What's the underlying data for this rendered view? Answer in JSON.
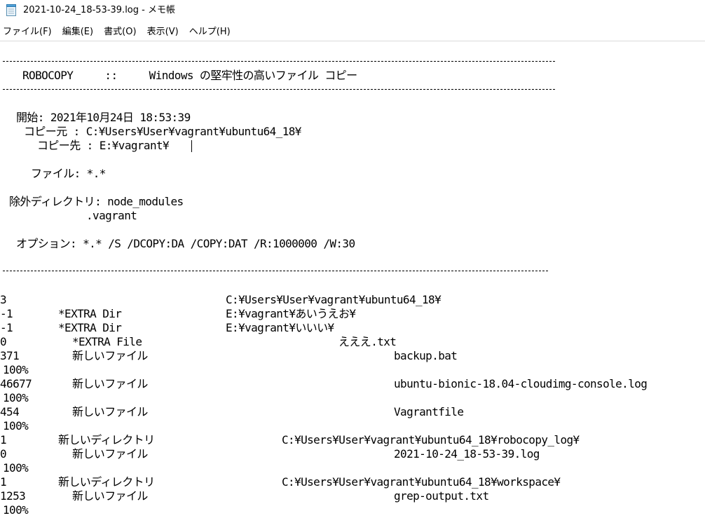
{
  "window": {
    "title": "2021-10-24_18-53-39.log - メモ帳",
    "icon": "notepad-icon"
  },
  "menu": [
    {
      "label": "ファイル(F)"
    },
    {
      "label": "編集(E)"
    },
    {
      "label": "書式(O)"
    },
    {
      "label": "表示(V)"
    },
    {
      "label": "ヘルプ(H)"
    }
  ],
  "log": {
    "header_title": "ROBOCOPY     ::     Windows の堅牢性の高いファイル コピー",
    "start": "開始: 2021年10月24日 18:53:39",
    "source": "コピー元 : C:¥Users¥User¥vagrant¥ubuntu64_18¥",
    "dest": "コピー先 : E:¥vagrant¥",
    "files": "ファイル: *.*",
    "exclude_dirs": "除外ディレクトリ: node_modules",
    "exclude_dirs_2": ".vagrant",
    "options": "オプション: *.* /S /DCOPY:DA /COPY:DAT /R:1000000 /W:30",
    "entries": [
      {
        "c1": "",
        "c2": "3",
        "c3": "C:¥Users¥User¥vagrant¥ubuntu64_18¥"
      },
      {
        "c1": "*EXTRA Dir",
        "c2": "-1",
        "c3": "E:¥vagrant¥あいうえお¥"
      },
      {
        "c1": "*EXTRA Dir",
        "c2": "-1",
        "c3": "E:¥vagrant¥いいい¥"
      },
      {
        "c1": "*EXTRA File",
        "c2": "0",
        "c3": "えええ.txt"
      },
      {
        "c1": "新しいファイル",
        "c2": "371",
        "c3": "backup.bat"
      },
      {
        "pct": "100%"
      },
      {
        "c1": "新しいファイル",
        "c2": "46677",
        "c3": "ubuntu-bionic-18.04-cloudimg-console.log"
      },
      {
        "pct": "100%"
      },
      {
        "c1": "新しいファイル",
        "c2": "454",
        "c3": "Vagrantfile"
      },
      {
        "pct": "100%"
      },
      {
        "c1": "新しいディレクトリ",
        "c2": "1",
        "c3": "C:¥Users¥User¥vagrant¥ubuntu64_18¥robocopy_log¥"
      },
      {
        "c1": "新しいファイル",
        "c2": "0",
        "c3": "2021-10-24_18-53-39.log"
      },
      {
        "pct": "100%"
      },
      {
        "c1": "新しいディレクトリ",
        "c2": "1",
        "c3": "C:¥Users¥User¥vagrant¥ubuntu64_18¥workspace¥"
      },
      {
        "c1": "新しいファイル",
        "c2": "1253",
        "c3": "grep-output.txt"
      },
      {
        "pct": "100%"
      }
    ]
  }
}
